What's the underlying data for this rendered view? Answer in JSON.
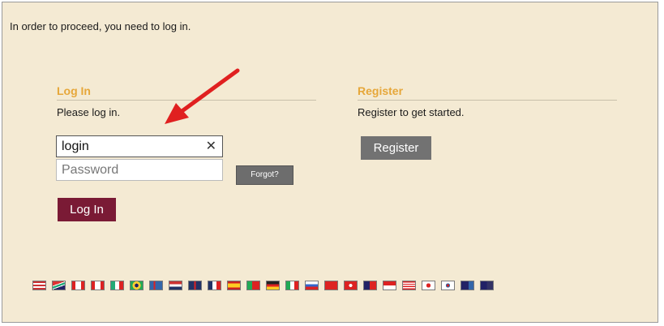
{
  "intro_text": "In order to proceed, you need to log in.",
  "login": {
    "title": "Log In",
    "subtitle": "Please log in.",
    "username_value": "login",
    "password_placeholder": "Password",
    "forgot_label": "Forgot?",
    "submit_label": "Log In"
  },
  "register": {
    "title": "Register",
    "subtitle": "Register to get started.",
    "button_label": "Register"
  },
  "colors": {
    "accent": "#e6a73a",
    "login_button": "#7a1a35",
    "panel_bg": "#f4ead3",
    "arrow": "#e02020"
  },
  "flags": [
    {
      "name": "us-flag",
      "bg": "linear-gradient(#c33 0 20%,#fff 20% 40%,#c33 40% 60%,#fff 60% 80%,#c33 80%)"
    },
    {
      "name": "za-flag",
      "bg": "linear-gradient(160deg,#d33 0 35%,#fff 35% 42%,#2a7 42% 58%,#fff 58% 65%,#226 65%)"
    },
    {
      "name": "ca-flag",
      "bg": "linear-gradient(90deg,#d22 0 28%,#fff 28% 72%,#d22 72%)"
    },
    {
      "name": "ca-fr-flag",
      "bg": "linear-gradient(90deg,#d22 0 28%,#fff 28% 72%,#d22 72%)"
    },
    {
      "name": "mx-flag",
      "bg": "linear-gradient(90deg,#2a7 0 33%,#fff 33% 66%,#d22 66%)"
    },
    {
      "name": "br-flag",
      "bg": "radial-gradient(circle,#226 0 25%,#fc3 26% 55%,#2a5 56%)"
    },
    {
      "name": "is-flag",
      "bg": "linear-gradient(90deg,#36a 0 30%,#d22 30% 45%,#36a 45%)"
    },
    {
      "name": "nl-flag",
      "bg": "linear-gradient(#c33 0 33%,#fff 33% 66%,#236 66%)"
    },
    {
      "name": "uk-flag",
      "bg": "linear-gradient(90deg,#236 0 42%,#d22 42% 58%,#236 58%)"
    },
    {
      "name": "fr-flag",
      "bg": "linear-gradient(90deg,#236 0 33%,#fff 33% 66%,#d22 66%)"
    },
    {
      "name": "es-flag",
      "bg": "linear-gradient(#c22 0 25%,#fc2 25% 75%,#c22 75%)"
    },
    {
      "name": "pt-flag",
      "bg": "linear-gradient(90deg,#2a5 0 40%,#d22 40%)"
    },
    {
      "name": "de-flag",
      "bg": "linear-gradient(#222 0 33%,#d22 33% 66%,#fc2 66%)"
    },
    {
      "name": "it-flag",
      "bg": "linear-gradient(90deg,#2a5 0 33%,#fff 33% 66%,#d22 66%)"
    },
    {
      "name": "ru-flag",
      "bg": "linear-gradient(#fff 0 33%,#36c 33% 66%,#d22 66%)"
    },
    {
      "name": "cn-flag",
      "bg": "#d22"
    },
    {
      "name": "hk-flag",
      "bg": "radial-gradient(circle,#fff 0 22%,#d22 24%)"
    },
    {
      "name": "tw-flag",
      "bg": "linear-gradient(90deg,#226 0 45%,#d22 45%)"
    },
    {
      "name": "sg-flag",
      "bg": "linear-gradient(#d22 0 50%,#fff 50%)"
    },
    {
      "name": "my-flag",
      "bg": "linear-gradient(#d22 0 14%,#fff 14% 28%,#d22 28% 42%,#fff 42% 56%,#d22 56% 70%,#fff 70% 84%,#d22 84%)"
    },
    {
      "name": "jp-flag",
      "bg": "radial-gradient(circle,#d22 0 28%,#fff 30%)"
    },
    {
      "name": "kr-flag",
      "bg": "radial-gradient(circle,#c22 0 18%,#36a 19% 28%,#fff 30%)"
    },
    {
      "name": "au-flag",
      "bg": "linear-gradient(90deg,#226 0 60%,#36a 60%)"
    },
    {
      "name": "nz-flag",
      "bg": "linear-gradient(90deg,#226 0 50%,#336 50%)"
    }
  ]
}
